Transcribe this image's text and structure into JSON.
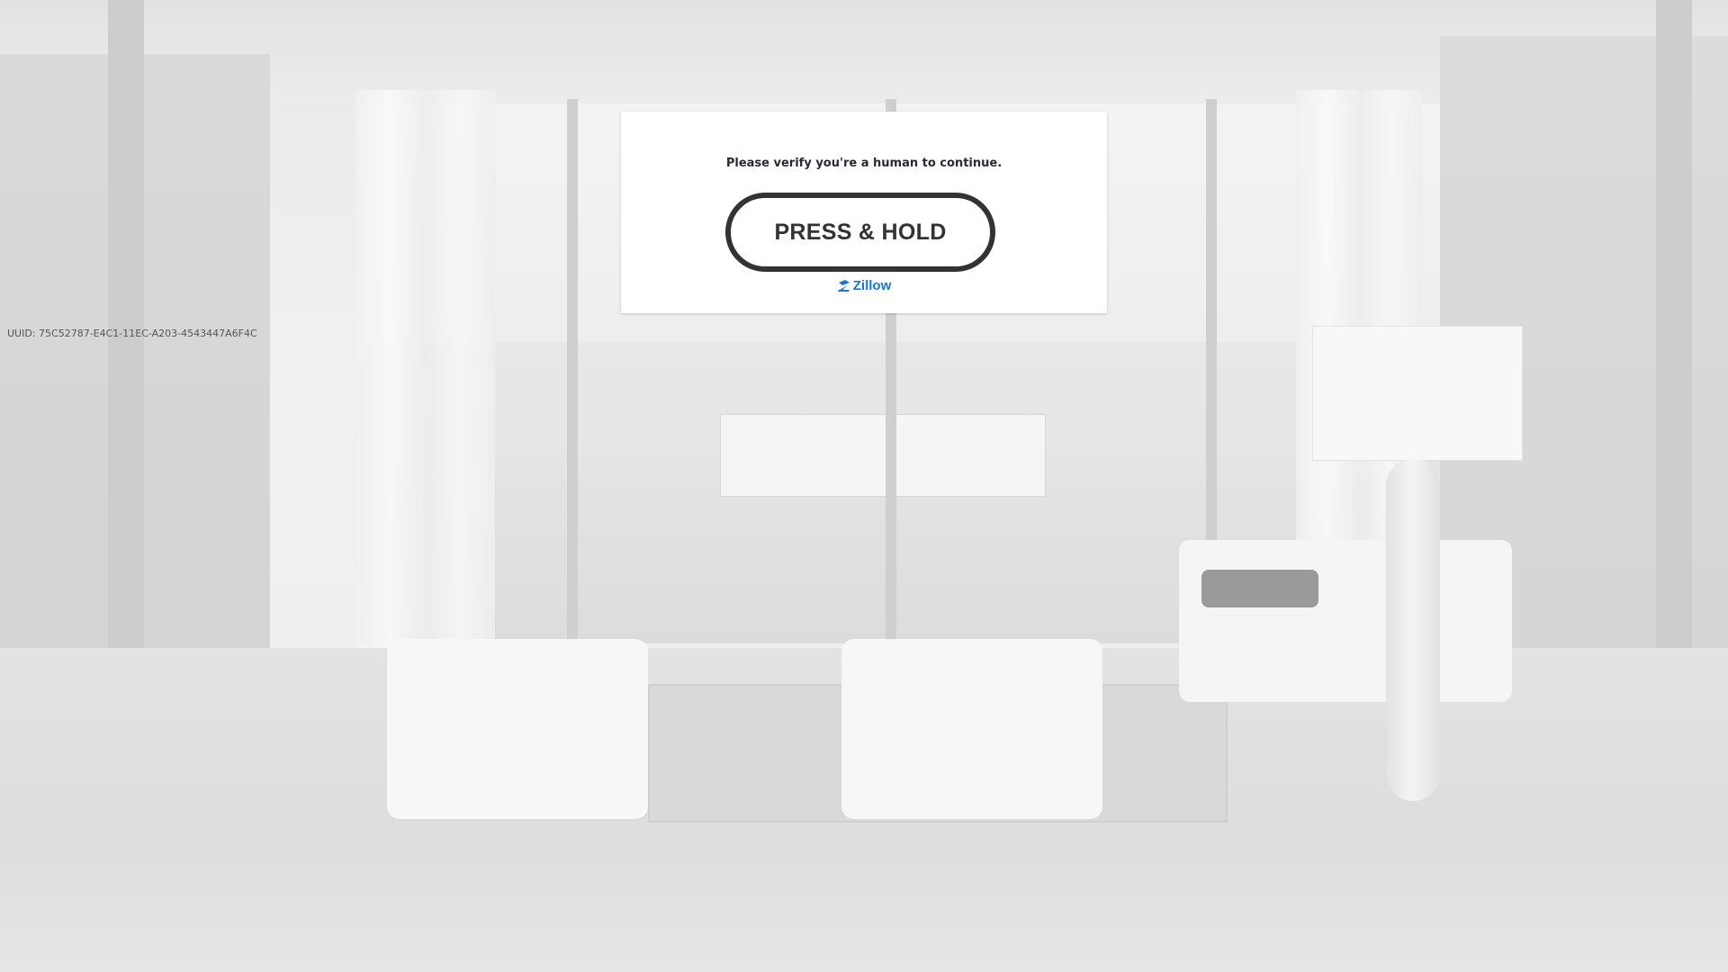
{
  "captcha": {
    "message": "Please verify you're a human to continue.",
    "button_label": "PRESS & HOLD",
    "brand_logo_text": "Zillow",
    "brand_color": "#1277e1",
    "button_border_color": "#333333"
  },
  "footer": {
    "uuid": "UUID: 75C52787-E4C1-11EC-A203-4543447A6F4C"
  },
  "background": {
    "description_icon": "living-room-photo"
  }
}
